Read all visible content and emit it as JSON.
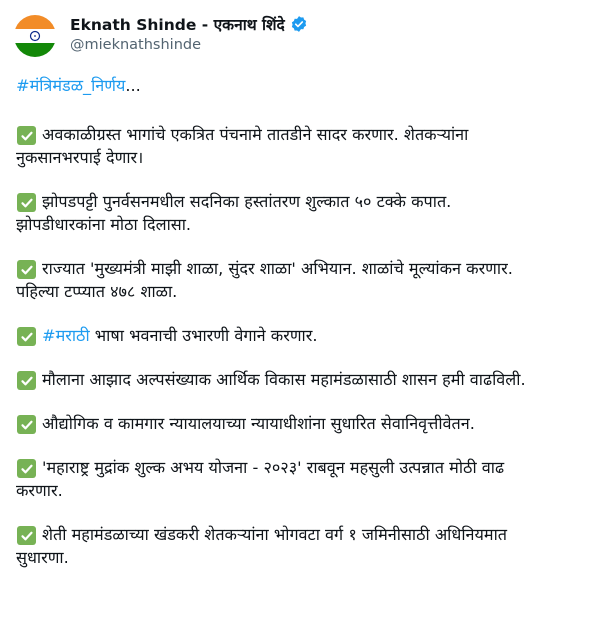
{
  "author": {
    "display_name": "Eknath Shinde - एकनाथ शिंदे",
    "handle": "@mieknathshinde",
    "verified": true,
    "avatar": "india-flag-avatar",
    "verified_icon": "verified-badge-icon",
    "verified_color": "#1d9bf0"
  },
  "tweet": {
    "hashtag": "#मंत्रिमंडळ_निर्णय",
    "hashtag_suffix": "...",
    "check_icon": "white-check-mark-icon",
    "check_color": "#77b255",
    "items": [
      {
        "line1": "अवकाळीग्रस्त भागांचे एकत्रित पंचनामे तातडीने सादर करणार. शेतकऱ्यांना",
        "line2": "नुकसानभरपाई देणार।"
      },
      {
        "line1": "झोपडपट्टी पुनर्वसनमधील सदनिका हस्तांतरण शुल्कात ५० टक्के कपात.",
        "line2": "झोपडीधारकांना मोठा दिलासा."
      },
      {
        "line1": "राज्यात 'मुख्यमंत्री माझी शाळा, सुंदर शाळा' अभियान. शाळांचे मूल्यांकन करणार.",
        "line2": "पहिल्या टप्प्यात ४७८ शाळा."
      },
      {
        "hashtag": "#मराठी",
        "line1": " भाषा भवनाची उभारणी वेगाने करणार."
      },
      {
        "line1": "मौलाना आझाद अल्पसंख्याक आर्थिक विकास महामंडळासाठी शासन हमी वाढविली."
      },
      {
        "line1": "औद्योगिक व कामगार न्यायालयाच्या न्यायाधीशांना सुधारित सेवानिवृत्तीवेतन."
      },
      {
        "line1": "'महाराष्ट्र मुद्रांक शुल्क अभय योजना - २०२३' राबवून महसुली उत्पन्नात मोठी वाढ",
        "line2": "करणार."
      },
      {
        "line1": "शेती महामंडळाच्या खंडकरी शेतकऱ्यांना भोगवटा वर्ग १ जमिनीसाठी अधिनियमात",
        "line2": "सुधारणा."
      }
    ]
  }
}
